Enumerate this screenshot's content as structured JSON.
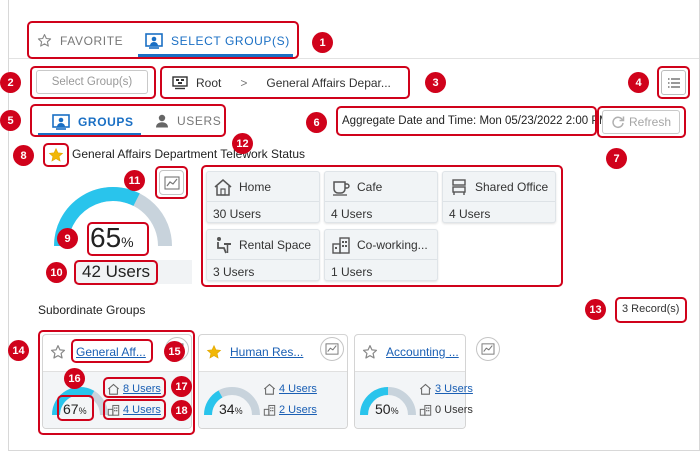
{
  "top_tabs": {
    "favorite": "FAVORITE",
    "select_groups": "SELECT GROUP(S)"
  },
  "select_groups_button": "Select Group(s)",
  "breadcrumb": {
    "root": "Root",
    "separator": ">",
    "current": "General Affairs Depar..."
  },
  "view_tabs": {
    "groups": "GROUPS",
    "users": "USERS"
  },
  "aggregate": {
    "label": "Aggregate Date and Time: Mon 05/23/2022 2:00 PM"
  },
  "refresh_button": "Refresh",
  "department": {
    "title": "General Affairs Department Telework Status",
    "gauge_percent": 65,
    "percent_symbol": "%",
    "users_total": "42 Users"
  },
  "status_cards": [
    {
      "icon": "home-icon",
      "label": "Home",
      "count": "30 Users"
    },
    {
      "icon": "cafe-icon",
      "label": "Cafe",
      "count": "4 Users"
    },
    {
      "icon": "shared-office-icon",
      "label": "Shared Office",
      "count": "4 Users"
    },
    {
      "icon": "rental-space-icon",
      "label": "Rental Space",
      "count": "3 Users"
    },
    {
      "icon": "coworking-icon",
      "label": "Co-working...",
      "count": "1 Users"
    }
  ],
  "subordinate": {
    "title": "Subordinate Groups",
    "record_count": "3 Record(s)",
    "groups": [
      {
        "name": "General Aff...",
        "favorite": false,
        "percent": 67,
        "percent_symbol": "%",
        "home_users": "8 Users",
        "office_users": "4 Users",
        "office_is_link": true
      },
      {
        "name": "Human Res...",
        "favorite": true,
        "percent": 34,
        "percent_symbol": "%",
        "home_users": "4 Users",
        "office_users": "2 Users",
        "office_is_link": true
      },
      {
        "name": "Accounting ...",
        "favorite": false,
        "percent": 50,
        "percent_symbol": "%",
        "home_users": "3 Users",
        "office_users": "0 Users",
        "office_is_link": false
      }
    ]
  },
  "callouts": [
    "1",
    "2",
    "3",
    "4",
    "5",
    "6",
    "7",
    "8",
    "9",
    "10",
    "11",
    "12",
    "13",
    "14",
    "15",
    "16",
    "17",
    "18"
  ],
  "colors": {
    "accent": "#1a6fc4",
    "gauge_fill": "#29c4ec",
    "gauge_track": "#c8d3dc",
    "callout_red": "#d0021b",
    "star_gold": "#f2b705"
  }
}
